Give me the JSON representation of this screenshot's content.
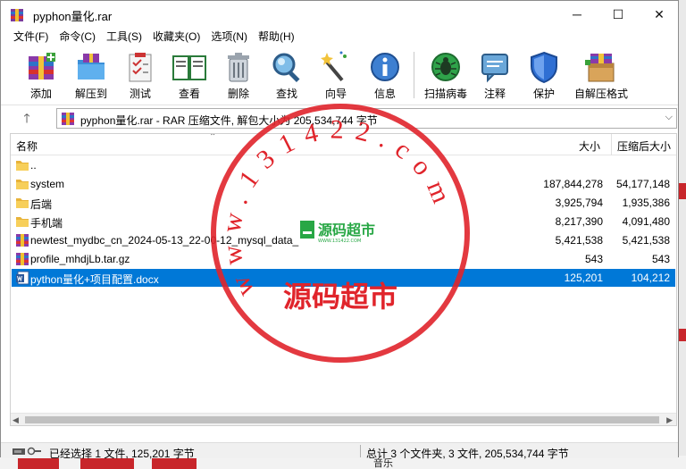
{
  "window": {
    "title": "pyphon量化.rar",
    "controls": {
      "minimize": "─",
      "maximize": "☐",
      "close": "✕"
    }
  },
  "menu": [
    "文件(F)",
    "命令(C)",
    "工具(S)",
    "收藏夹(O)",
    "选项(N)",
    "帮助(H)"
  ],
  "toolbar": [
    {
      "label": "添加",
      "icon": "add-books-icon"
    },
    {
      "label": "解压到",
      "icon": "extract-folder-icon"
    },
    {
      "label": "测试",
      "icon": "test-checklist-icon"
    },
    {
      "label": "查看",
      "icon": "view-book-icon"
    },
    {
      "label": "删除",
      "icon": "trash-icon"
    },
    {
      "label": "查找",
      "icon": "magnifier-icon"
    },
    {
      "label": "向导",
      "icon": "wizard-wand-icon"
    },
    {
      "label": "信息",
      "icon": "info-icon"
    },
    {
      "label": "扫描病毒",
      "icon": "virus-scan-icon"
    },
    {
      "label": "注释",
      "icon": "comment-icon"
    },
    {
      "label": "保护",
      "icon": "shield-icon"
    },
    {
      "label": "自解压格式",
      "icon": "sfx-box-icon"
    }
  ],
  "address": {
    "up": "🡑",
    "path": "pyphon量化.rar - RAR 压缩文件, 解包大小为 205,534,744 字节",
    "dropdown": "⌵"
  },
  "columns": {
    "name": "名称",
    "size": "大小",
    "packed": "压缩后大小",
    "sort_arrow": "⌃"
  },
  "files": [
    {
      "name": "..",
      "size": "",
      "packed": "",
      "type": "folder"
    },
    {
      "name": "system",
      "size": "187,844,278",
      "packed": "54,177,148",
      "type": "folder"
    },
    {
      "name": "后端",
      "size": "3,925,794",
      "packed": "1,935,386",
      "type": "folder"
    },
    {
      "name": "手机端",
      "size": "8,217,390",
      "packed": "4,091,480",
      "type": "folder"
    },
    {
      "name": "newtest_mydbc_cn_2024-05-13_22-00-12_mysql_data_",
      "size": "5,421,538",
      "packed": "5,421,538",
      "type": "archive"
    },
    {
      "name": "profile_mhdjLb.tar.gz",
      "size": "543",
      "packed": "543",
      "type": "archive"
    },
    {
      "name": "python量化+项目配置.docx",
      "size": "125,201",
      "packed": "104,212",
      "type": "docx",
      "selected": true
    }
  ],
  "status": {
    "left": "已经选择 1 文件, 125,201 字节",
    "right": "总计 3 个文件夹, 3 文件, 205,534,744 字节"
  },
  "watermark": {
    "ring_text": "www.131422.com",
    "center_text": "源码超市",
    "badge": "源码超市",
    "badge_sub": "WWW.131422.COM"
  },
  "background": {
    "bottom_text": "音乐"
  },
  "colors": {
    "selection": "#0078d7",
    "watermark_red": "#e0242b",
    "status_bg": "#f0f0f0"
  }
}
